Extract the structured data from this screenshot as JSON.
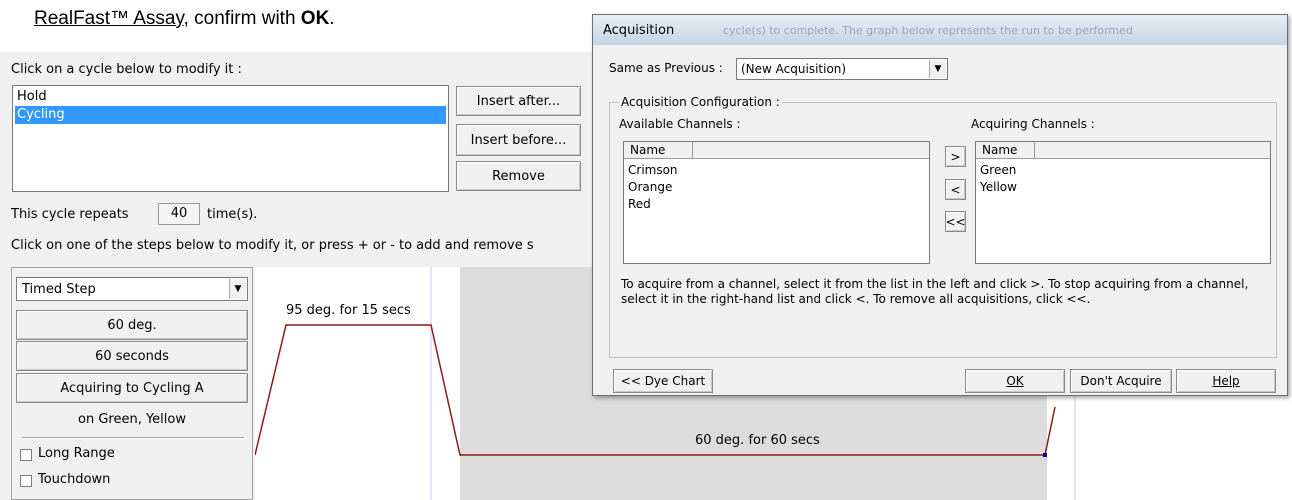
{
  "instruction": {
    "link_text": "RealFast™ Assay",
    "middle_text": ", confirm with ",
    "bold_text": "OK",
    "end_text": "."
  },
  "profile": {
    "click_cycle_label": "Click on a cycle below to modify it :",
    "cycles": [
      "Hold",
      "Cycling"
    ],
    "insert_after": "Insert after...",
    "insert_before": "Insert before...",
    "remove": "Remove",
    "repeats_prefix": "This cycle repeats",
    "repeats_value": "40",
    "repeats_suffix": "time(s).",
    "steps_instruction": "Click on one of the steps below to modify it, or press + or - to add and remove s"
  },
  "step": {
    "type": "Timed Step",
    "temperature": "60 deg.",
    "duration": "60 seconds",
    "acquiring": "Acquiring to Cycling A",
    "channels": "on Green, Yellow",
    "long_range": "Long Range",
    "touchdown": "Touchdown"
  },
  "graph": {
    "step1_label": "95 deg. for 15 secs",
    "step2_label": "60 deg. for 60 secs",
    "line_color": "#8b1a1a"
  },
  "dialog": {
    "title": "Acquisition",
    "same_as_label": "Same as Previous :",
    "same_as_value": "(New Acquisition)",
    "group_label": "Acquisition Configuration :",
    "available_label": "Available Channels :",
    "acquiring_label": "Acquiring Channels :",
    "col_name": "Name",
    "available": [
      "Crimson",
      "Orange",
      "Red"
    ],
    "acquiring": [
      "Green",
      "Yellow"
    ],
    "add_btn": ">",
    "remove_btn": "<",
    "remove_all_btn": "<<",
    "help_text": "To acquire from a channel, select it from the list in the left and click >. To stop acquiring from a channel, select it in the right-hand list and click <. To remove all acquisitions, click <<.",
    "dye_chart": "<< Dye Chart",
    "ok": "OK",
    "dont_acquire": "Don't Acquire",
    "help": "Help",
    "background_title_fragments": [
      "cycle(s) to complete. The graph below represents the run to be performed"
    ]
  }
}
